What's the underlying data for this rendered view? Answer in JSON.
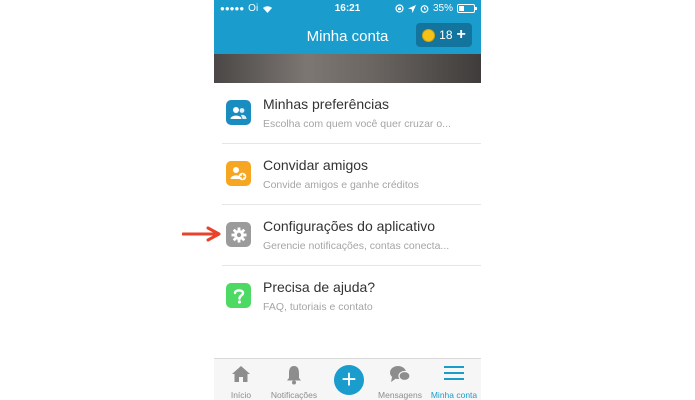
{
  "status_bar": {
    "carrier": "Oi",
    "time": "16:21",
    "battery": "35%"
  },
  "header": {
    "title": "Minha conta",
    "credits": "18",
    "add_label": "+"
  },
  "menu": [
    {
      "title": "Minhas preferências",
      "subtitle": "Escolha com quem você quer cruzar o...",
      "icon": "preferences-icon",
      "color": "#1a8dc0"
    },
    {
      "title": "Convidar amigos",
      "subtitle": "Convide amigos e ganhe créditos",
      "icon": "invite-friends-icon",
      "color": "#f5a623"
    },
    {
      "title": "Configurações do aplicativo",
      "subtitle": "Gerencie notificações, contas conecta...",
      "icon": "gear-icon",
      "color": "#9b9b9b"
    },
    {
      "title": "Precisa de ajuda?",
      "subtitle": "FAQ, tutoriais e contato",
      "icon": "help-icon",
      "color": "#4cd964"
    }
  ],
  "tabs": [
    {
      "label": "Início",
      "icon": "home-icon"
    },
    {
      "label": "Notificações",
      "icon": "bell-icon"
    },
    {
      "label": "+",
      "icon": "plus-icon"
    },
    {
      "label": "Mensagens",
      "icon": "messages-icon"
    },
    {
      "label": "Minha conta",
      "icon": "menu-icon"
    }
  ],
  "colors": {
    "accent": "#1a9ccd",
    "annotation_arrow": "#e8412c"
  }
}
